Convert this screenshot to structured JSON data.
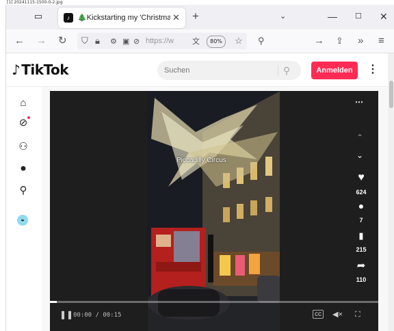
{
  "top_note": "[1] 20241115-1500-0-2.jpg",
  "browser": {
    "tab_title": "🎄Kickstarting my 'Christmas",
    "url_text": "https://w",
    "zoom": "80%"
  },
  "tiktok": {
    "logo_text": "TikTok",
    "search_placeholder": "Suchen",
    "login_label": "Anmelden"
  },
  "video": {
    "caption": "Piccadilly Circus",
    "time": "00:00 / 00:15",
    "progress": 0.02,
    "stats": {
      "likes": "624",
      "comments": "7",
      "saves": "215",
      "shares": "110"
    }
  },
  "icons": {
    "tab_list": "tab-list-icon",
    "favicon": "tiktok-favicon",
    "sidebar": [
      "home-icon",
      "explore-icon",
      "following-icon",
      "live-icon",
      "profile-icon",
      "avatar-icon"
    ]
  }
}
